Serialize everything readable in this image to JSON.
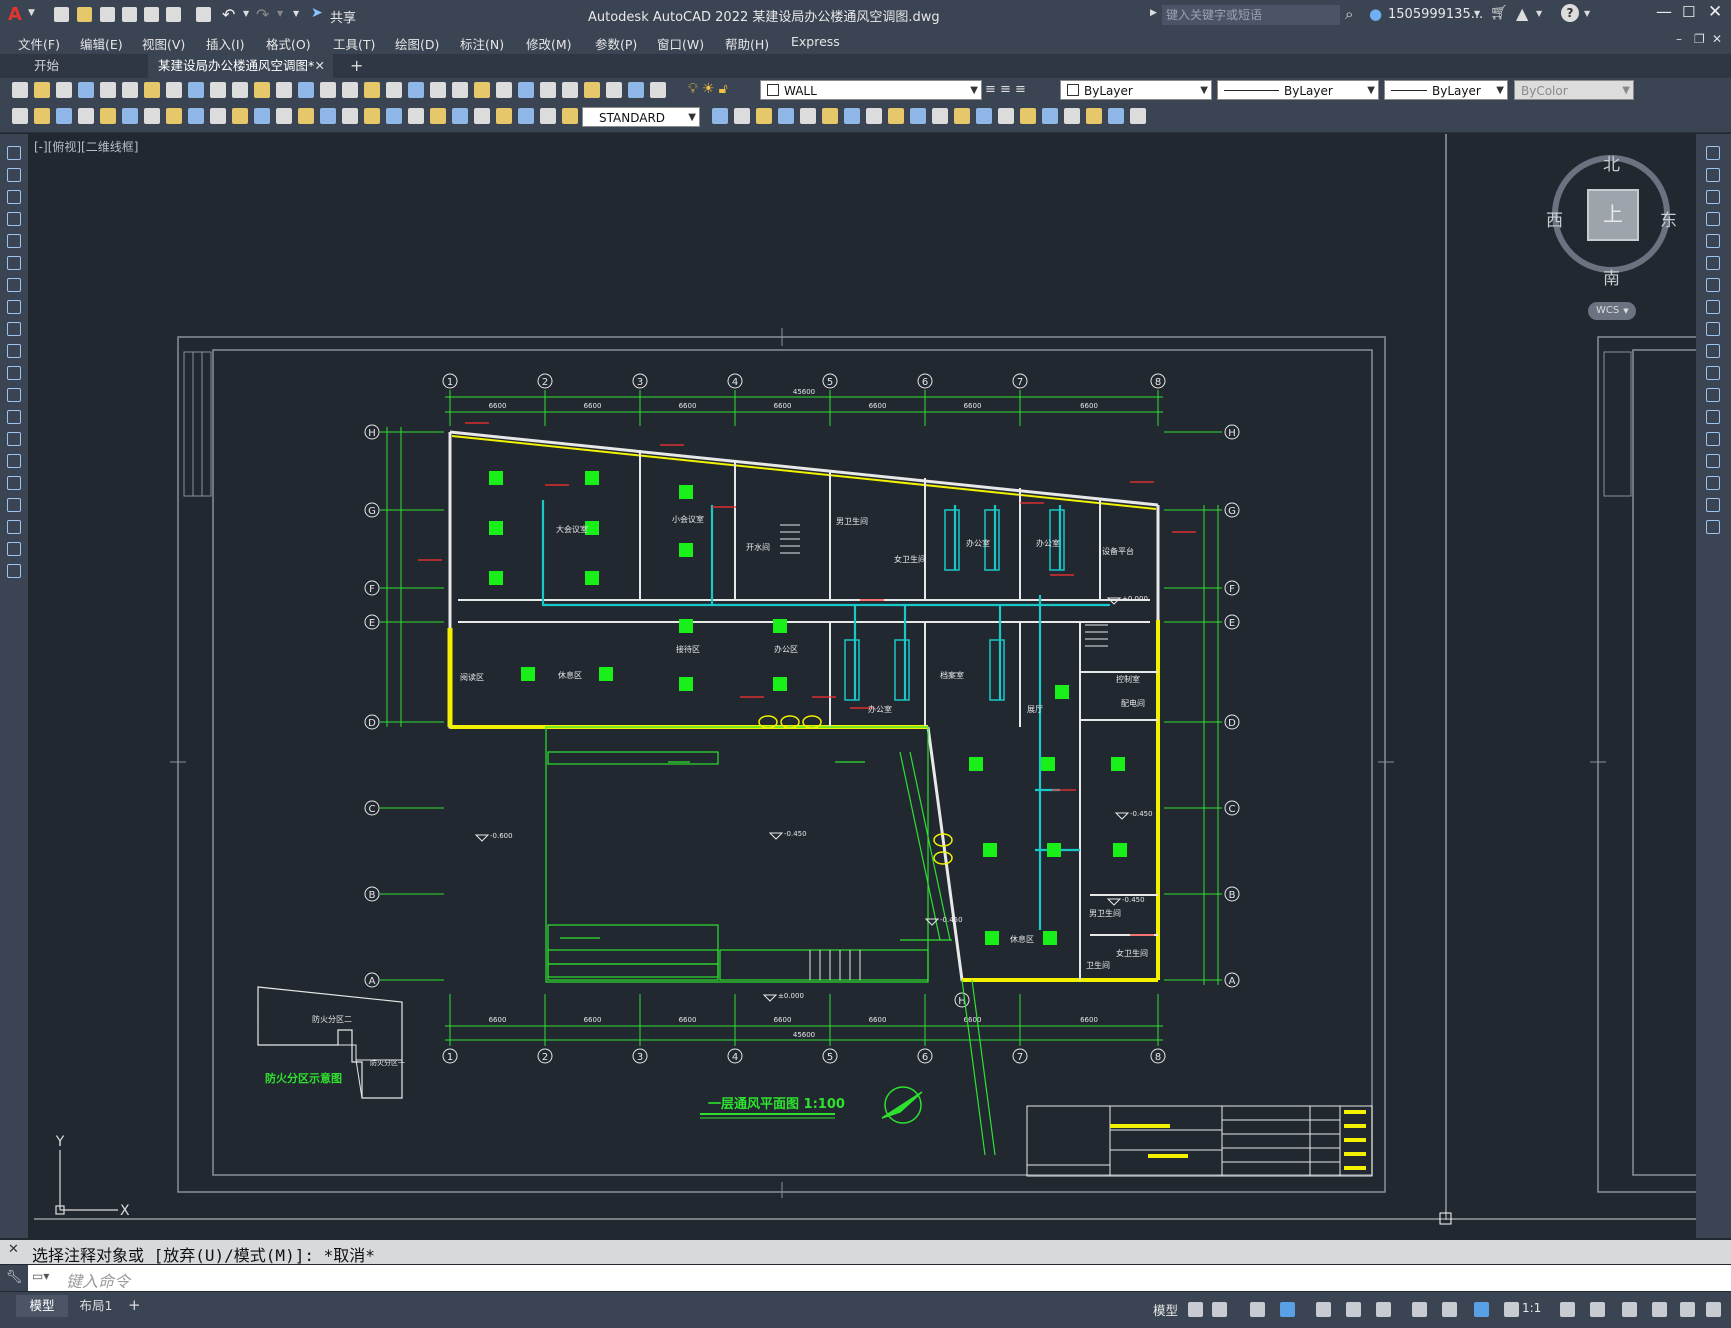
{
  "window": {
    "app_logo": "A",
    "title": "Autodesk AutoCAD 2022    某建设局办公楼通风空调图.dwg",
    "share_label": "共享",
    "search_placeholder": "键入关键字或短语",
    "user_name": "1505999135...",
    "icons": [
      "new-icon",
      "open-icon",
      "save-icon",
      "saveas-icon",
      "plot-icon",
      "undo-icon",
      "redo-icon",
      "share-icon",
      "search-icon",
      "user-icon",
      "cart-icon",
      "autodesk-icon",
      "help-icon",
      "minimize-icon",
      "maximize-icon",
      "close-icon"
    ]
  },
  "menu": {
    "items": [
      "文件(F)",
      "编辑(E)",
      "视图(V)",
      "插入(I)",
      "格式(O)",
      "工具(T)",
      "绘图(D)",
      "标注(N)",
      "修改(M)",
      "参数(P)",
      "窗口(W)",
      "帮助(H)",
      "Express"
    ]
  },
  "tabs": {
    "start": "开始",
    "active": "某建设局办公楼通风空调图*",
    "add": "+"
  },
  "properties": {
    "layer": "WALL",
    "color": "ByLayer",
    "linetype": "ByLayer",
    "lineweight": "ByLayer",
    "plotstyle": "ByColor",
    "textstyle": "STANDARD"
  },
  "viewport": {
    "label": "[-][俯视][二维线框]",
    "viewcube": {
      "north": "北",
      "south": "南",
      "east": "东",
      "west": "西",
      "top": "上",
      "wcs": "WCS"
    },
    "ucs": {
      "x": "X",
      "y": "Y"
    }
  },
  "drawing": {
    "plan_title": "一层通风平面图  1:100",
    "fire_zone_title": "防火分区示意图",
    "fire_zone_1": "防火分区二",
    "fire_zone_2": "防火分区一",
    "grid_cols": [
      "1",
      "2",
      "3",
      "4",
      "5",
      "6",
      "7",
      "8"
    ],
    "grid_rows": [
      "H",
      "G",
      "F",
      "E",
      "D",
      "C",
      "B",
      "A"
    ],
    "dims_top": [
      "6600",
      "6600",
      "6600",
      "6600",
      "6600",
      "6600",
      "6600"
    ],
    "total_dim": "45600",
    "rooms": [
      "大会议室",
      "小会议室",
      "开水间",
      "男卫生间",
      "女卫生间",
      "办公室",
      "办公室",
      "设备平台",
      "接待区",
      "办公区",
      "休息区",
      "阅读区",
      "档案室",
      "办公室",
      "展厅",
      "控制室",
      "配电间",
      "休息区",
      "男卫生间",
      "女卫生间",
      "卫生间"
    ],
    "elevations": [
      "-0.600",
      "-0.450",
      "±0.000",
      "±0.000",
      "-0.450",
      "-0.450",
      "-0.450"
    ]
  },
  "command": {
    "history": "选择注释对象或 [放弃(U)/模式(M)]: *取消*",
    "placeholder": "键入命令"
  },
  "status": {
    "model_tab": "模型",
    "layout_tab": "布局1",
    "add": "+",
    "model_label": "模型",
    "scale": "1:1"
  }
}
